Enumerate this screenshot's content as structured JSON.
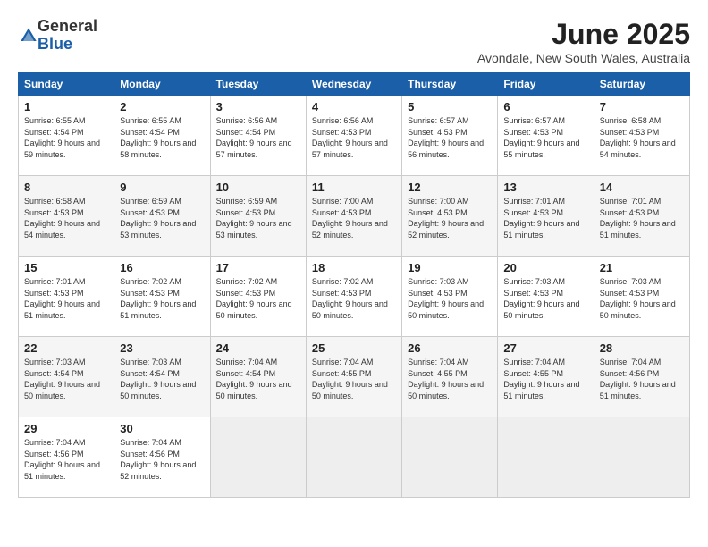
{
  "logo": {
    "general": "General",
    "blue": "Blue"
  },
  "header": {
    "title": "June 2025",
    "subtitle": "Avondale, New South Wales, Australia"
  },
  "columns": [
    "Sunday",
    "Monday",
    "Tuesday",
    "Wednesday",
    "Thursday",
    "Friday",
    "Saturday"
  ],
  "weeks": [
    [
      {
        "day": "1",
        "sunrise": "6:55 AM",
        "sunset": "4:54 PM",
        "daylight": "9 hours and 59 minutes."
      },
      {
        "day": "2",
        "sunrise": "6:55 AM",
        "sunset": "4:54 PM",
        "daylight": "9 hours and 58 minutes."
      },
      {
        "day": "3",
        "sunrise": "6:56 AM",
        "sunset": "4:54 PM",
        "daylight": "9 hours and 57 minutes."
      },
      {
        "day": "4",
        "sunrise": "6:56 AM",
        "sunset": "4:53 PM",
        "daylight": "9 hours and 57 minutes."
      },
      {
        "day": "5",
        "sunrise": "6:57 AM",
        "sunset": "4:53 PM",
        "daylight": "9 hours and 56 minutes."
      },
      {
        "day": "6",
        "sunrise": "6:57 AM",
        "sunset": "4:53 PM",
        "daylight": "9 hours and 55 minutes."
      },
      {
        "day": "7",
        "sunrise": "6:58 AM",
        "sunset": "4:53 PM",
        "daylight": "9 hours and 54 minutes."
      }
    ],
    [
      {
        "day": "8",
        "sunrise": "6:58 AM",
        "sunset": "4:53 PM",
        "daylight": "9 hours and 54 minutes."
      },
      {
        "day": "9",
        "sunrise": "6:59 AM",
        "sunset": "4:53 PM",
        "daylight": "9 hours and 53 minutes."
      },
      {
        "day": "10",
        "sunrise": "6:59 AM",
        "sunset": "4:53 PM",
        "daylight": "9 hours and 53 minutes."
      },
      {
        "day": "11",
        "sunrise": "7:00 AM",
        "sunset": "4:53 PM",
        "daylight": "9 hours and 52 minutes."
      },
      {
        "day": "12",
        "sunrise": "7:00 AM",
        "sunset": "4:53 PM",
        "daylight": "9 hours and 52 minutes."
      },
      {
        "day": "13",
        "sunrise": "7:01 AM",
        "sunset": "4:53 PM",
        "daylight": "9 hours and 51 minutes."
      },
      {
        "day": "14",
        "sunrise": "7:01 AM",
        "sunset": "4:53 PM",
        "daylight": "9 hours and 51 minutes."
      }
    ],
    [
      {
        "day": "15",
        "sunrise": "7:01 AM",
        "sunset": "4:53 PM",
        "daylight": "9 hours and 51 minutes."
      },
      {
        "day": "16",
        "sunrise": "7:02 AM",
        "sunset": "4:53 PM",
        "daylight": "9 hours and 51 minutes."
      },
      {
        "day": "17",
        "sunrise": "7:02 AM",
        "sunset": "4:53 PM",
        "daylight": "9 hours and 50 minutes."
      },
      {
        "day": "18",
        "sunrise": "7:02 AM",
        "sunset": "4:53 PM",
        "daylight": "9 hours and 50 minutes."
      },
      {
        "day": "19",
        "sunrise": "7:03 AM",
        "sunset": "4:53 PM",
        "daylight": "9 hours and 50 minutes."
      },
      {
        "day": "20",
        "sunrise": "7:03 AM",
        "sunset": "4:53 PM",
        "daylight": "9 hours and 50 minutes."
      },
      {
        "day": "21",
        "sunrise": "7:03 AM",
        "sunset": "4:53 PM",
        "daylight": "9 hours and 50 minutes."
      }
    ],
    [
      {
        "day": "22",
        "sunrise": "7:03 AM",
        "sunset": "4:54 PM",
        "daylight": "9 hours and 50 minutes."
      },
      {
        "day": "23",
        "sunrise": "7:03 AM",
        "sunset": "4:54 PM",
        "daylight": "9 hours and 50 minutes."
      },
      {
        "day": "24",
        "sunrise": "7:04 AM",
        "sunset": "4:54 PM",
        "daylight": "9 hours and 50 minutes."
      },
      {
        "day": "25",
        "sunrise": "7:04 AM",
        "sunset": "4:55 PM",
        "daylight": "9 hours and 50 minutes."
      },
      {
        "day": "26",
        "sunrise": "7:04 AM",
        "sunset": "4:55 PM",
        "daylight": "9 hours and 50 minutes."
      },
      {
        "day": "27",
        "sunrise": "7:04 AM",
        "sunset": "4:55 PM",
        "daylight": "9 hours and 51 minutes."
      },
      {
        "day": "28",
        "sunrise": "7:04 AM",
        "sunset": "4:56 PM",
        "daylight": "9 hours and 51 minutes."
      }
    ],
    [
      {
        "day": "29",
        "sunrise": "7:04 AM",
        "sunset": "4:56 PM",
        "daylight": "9 hours and 51 minutes."
      },
      {
        "day": "30",
        "sunrise": "7:04 AM",
        "sunset": "4:56 PM",
        "daylight": "9 hours and 52 minutes."
      },
      null,
      null,
      null,
      null,
      null
    ]
  ]
}
